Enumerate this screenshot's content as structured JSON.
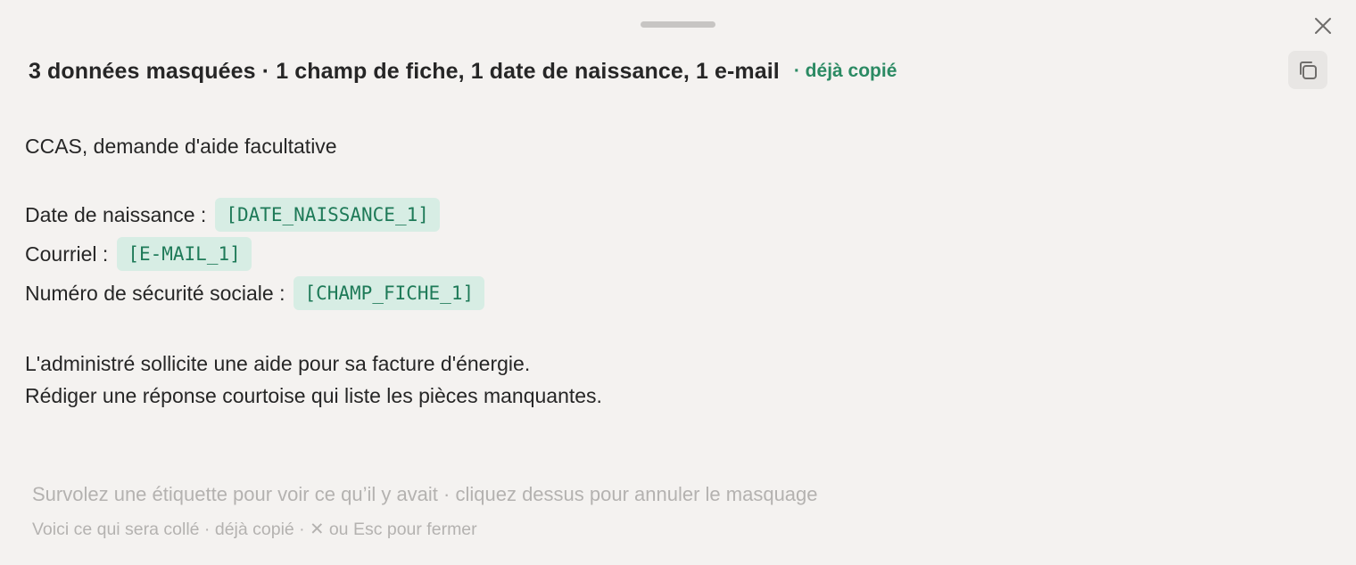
{
  "panel": {
    "header": {
      "title": "3 données masquées · 1 champ de fiche, 1 date de naissance, 1 e-mail",
      "status": "· déjà copié"
    },
    "close_icon": "close-icon",
    "copy_icon": "copy-icon"
  },
  "content": {
    "intro": "CCAS, demande d'aide facultative",
    "fields": [
      {
        "label": "Date de naissance :",
        "tag": "[DATE_NAISSANCE_1]"
      },
      {
        "label": "Courriel :",
        "tag": "[E-MAIL_1]"
      },
      {
        "label": "Numéro de sécurité sociale :",
        "tag": "[CHAMP_FICHE_1]"
      }
    ],
    "body": [
      "L'administré sollicite une aide pour sa facture d'énergie.",
      "Rédiger une réponse courtoise qui liste les pièces manquantes."
    ]
  },
  "footer": {
    "hint_primary": "Survolez une étiquette pour voir ce qu’il y avait · cliquez dessus pour annuler le masquage",
    "hint_secondary": "Voici ce qui sera collé · déjà copié · ✕ ou Esc pour fermer"
  },
  "colors": {
    "background": "#f4f2f0",
    "accent": "#2b8a63",
    "tag_bg": "#d7ede4",
    "tag_text": "#1e7a58",
    "hint": "#b4b2b0"
  }
}
